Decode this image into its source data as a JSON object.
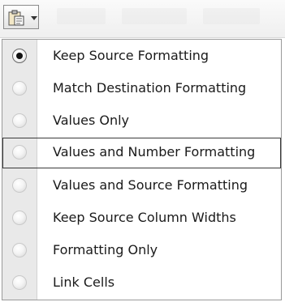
{
  "toolbar": {
    "paste_options_icon": "clipboard-icon",
    "dropdown_icon": "chevron-down-icon"
  },
  "menu": {
    "items": [
      {
        "label": "Keep Source Formatting",
        "checked": true
      },
      {
        "label": "Match Destination Formatting",
        "checked": false
      },
      {
        "label": "Values Only",
        "checked": false
      },
      {
        "label": "Values and Number Formatting",
        "checked": false,
        "highlighted": true
      },
      {
        "label": "Values and Source Formatting",
        "checked": false
      },
      {
        "label": "Keep Source Column Widths",
        "checked": false
      },
      {
        "label": "Formatting Only",
        "checked": false
      },
      {
        "label": "Link Cells",
        "checked": false
      }
    ]
  }
}
